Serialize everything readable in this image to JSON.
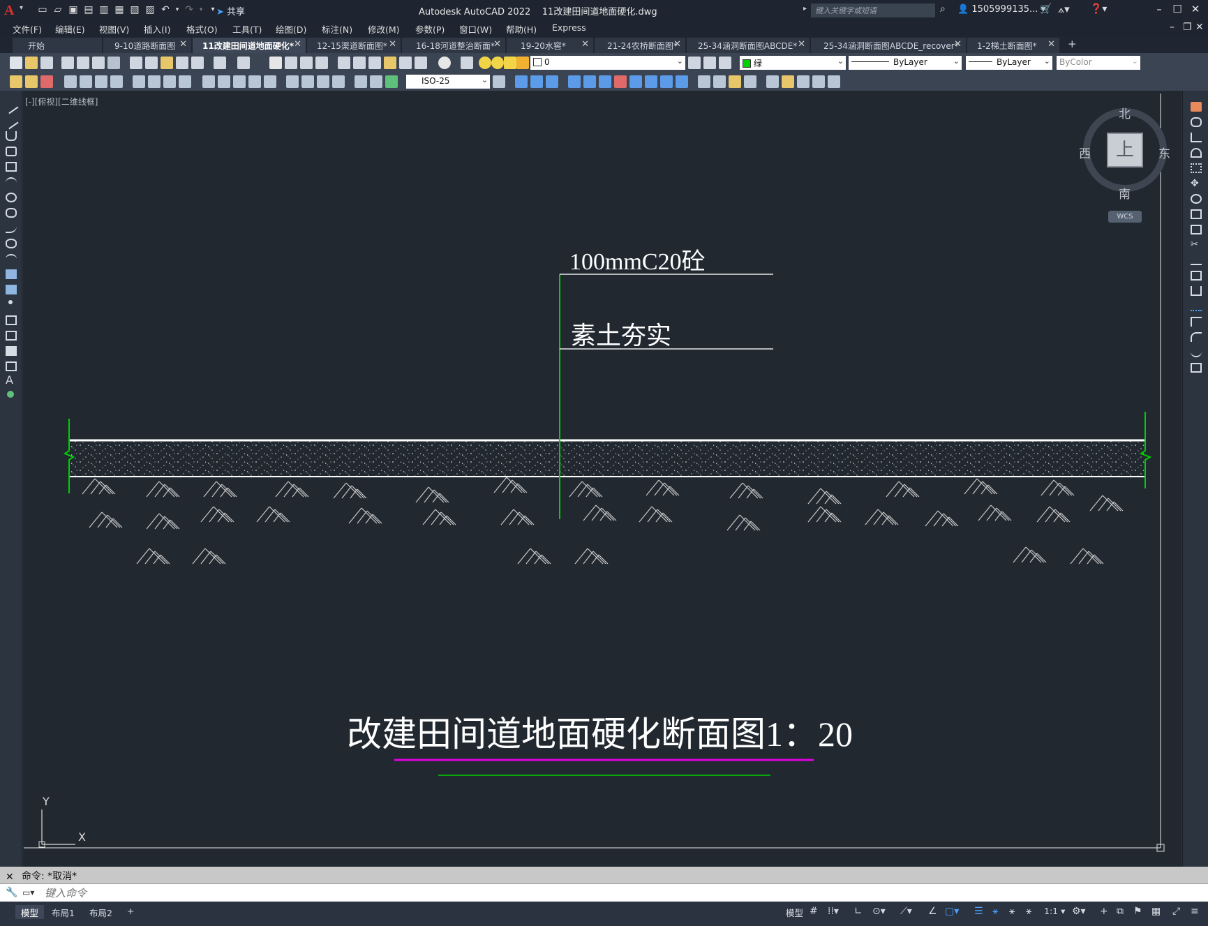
{
  "app": {
    "title": "Autodesk AutoCAD 2022",
    "filename": "11改建田间道地面硬化.dwg",
    "share_label": "共享",
    "search_placeholder": "键入关键字或短语",
    "username": "1505999135...",
    "accent_color": "#e0312b"
  },
  "menu": [
    "文件(F)",
    "编辑(E)",
    "视图(V)",
    "插入(I)",
    "格式(O)",
    "工具(T)",
    "绘图(D)",
    "标注(N)",
    "修改(M)",
    "参数(P)",
    "窗口(W)",
    "帮助(H)",
    "Express"
  ],
  "tabs": [
    {
      "label": "开始",
      "closable": false,
      "active": false
    },
    {
      "label": "9-10道路断面图",
      "closable": true,
      "active": false
    },
    {
      "label": "11改建田间道地面硬化*",
      "closable": true,
      "active": true
    },
    {
      "label": "12-15渠道断面图*",
      "closable": true,
      "active": false
    },
    {
      "label": "16-18河道整治断面*",
      "closable": true,
      "active": false
    },
    {
      "label": "19-20水窖*",
      "closable": true,
      "active": false
    },
    {
      "label": "21-24农桥断面图*",
      "closable": true,
      "active": false
    },
    {
      "label": "25-34涵洞断面图ABCDE*",
      "closable": true,
      "active": false
    },
    {
      "label": "25-34涵洞断面图ABCDE_recover*",
      "closable": true,
      "active": false
    },
    {
      "label": "1-2梯土断面图*",
      "closable": true,
      "active": false
    }
  ],
  "toolbar": {
    "layer_value": "0",
    "color_value": "绿",
    "color_swatch": "#00d000",
    "linetype_value": "ByLayer",
    "lineweight_value": "ByLayer",
    "plotstyle_value": "ByColor",
    "dimstyle_value": "ISO-25"
  },
  "viewport": {
    "label": "[-][俯视][二维线框]"
  },
  "drawing": {
    "label_top": "100mmC20砼",
    "label_bottom": "素土夯实",
    "title": "改建田间道地面硬化断面图1：20",
    "leader_color": "#00d000",
    "underline_primary_color": "#e000e0",
    "underline_secondary_color": "#00d000"
  },
  "viewcube": {
    "north": "北",
    "south": "南",
    "east": "东",
    "west": "西",
    "face": "上",
    "wcs": "WCS"
  },
  "ucs": {
    "x": "X",
    "y": "Y"
  },
  "command": {
    "history": "命令: *取消*",
    "placeholder": "键入命令"
  },
  "status": {
    "layout_tabs": [
      "模型",
      "布局1",
      "布局2"
    ],
    "model_label": "模型",
    "scale": "1:1"
  }
}
